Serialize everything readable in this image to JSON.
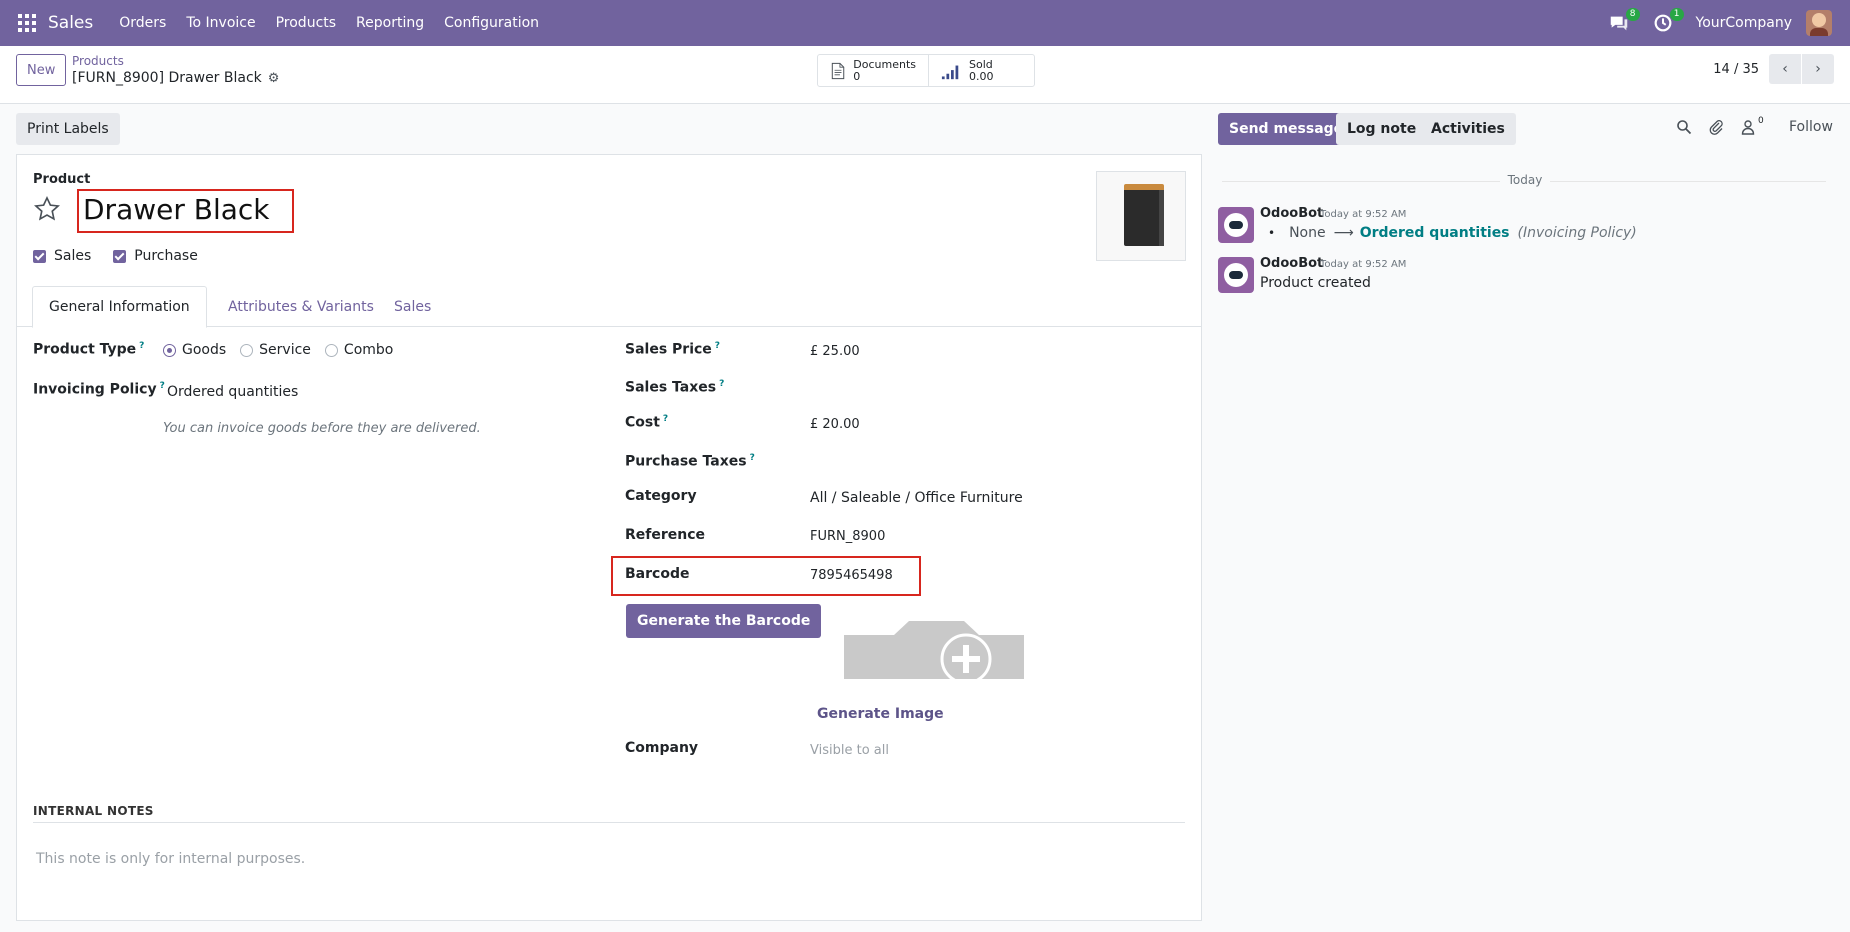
{
  "navbar": {
    "app_name": "Sales",
    "menu": [
      "Orders",
      "To Invoice",
      "Products",
      "Reporting",
      "Configuration"
    ],
    "messages_count": "8",
    "activities_count": "1",
    "company": "YourCompany",
    "color": "#71639e"
  },
  "control_panel": {
    "new_label": "New",
    "breadcrumb": "Products",
    "record_title": "[FURN_8900] Drawer Black",
    "smart_buttons": {
      "documents": {
        "label": "Documents",
        "value": "0"
      },
      "sold": {
        "label": "Sold",
        "value": "0.00"
      }
    },
    "pager": "14 / 35"
  },
  "status_bar": {
    "print_labels": "Print Labels"
  },
  "form": {
    "product_label": "Product",
    "name": "Drawer Black",
    "checks": {
      "sales": "Sales",
      "purchase": "Purchase"
    },
    "tabs": [
      "General Information",
      "Attributes & Variants",
      "Sales"
    ],
    "product_type_label": "Product Type",
    "product_type_options": [
      "Goods",
      "Service",
      "Combo"
    ],
    "product_type_selected": "Goods",
    "invoicing_policy_label": "Invoicing Policy",
    "invoicing_policy_value": "Ordered quantities",
    "invoicing_help": "You can invoice goods before they are delivered.",
    "sales_price_label": "Sales Price",
    "sales_price_value": "£ 25.00",
    "sales_taxes_label": "Sales Taxes",
    "cost_label": "Cost",
    "cost_value": "£ 20.00",
    "purchase_taxes_label": "Purchase Taxes",
    "category_label": "Category",
    "category_value": "All / Saleable / Office Furniture",
    "reference_label": "Reference",
    "reference_value": "FURN_8900",
    "barcode_label": "Barcode",
    "barcode_value": "7895465498",
    "generate_barcode": "Generate the Barcode",
    "generate_image": "Generate Image",
    "company_label": "Company",
    "company_placeholder": "Visible to all",
    "help_mark": "?",
    "internal_notes_heading": "INTERNAL NOTES",
    "internal_notes_placeholder": "This note is only for internal purposes."
  },
  "chatter": {
    "send_message": "Send message",
    "log_note": "Log note",
    "activities": "Activities",
    "followers_count": "0",
    "follow": "Follow",
    "date_separator": "Today",
    "messages": [
      {
        "author": "OdooBot",
        "date": "Today at 9:52 AM",
        "tracking": {
          "old": "None",
          "new": "Ordered quantities",
          "field": "(Invoicing Policy)"
        }
      },
      {
        "author": "OdooBot",
        "date": "Today at 9:52 AM",
        "body": "Product created"
      }
    ]
  }
}
